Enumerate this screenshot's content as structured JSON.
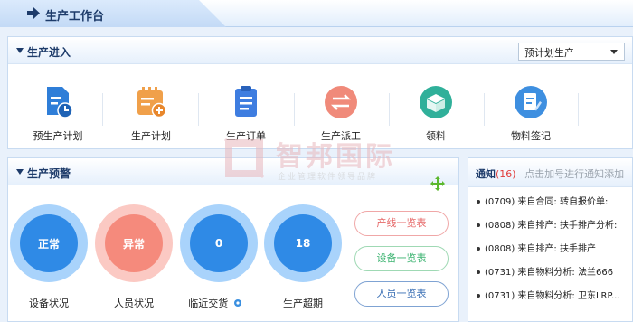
{
  "page_title": "生产工作台",
  "entry": {
    "title": "生产进入",
    "select_value": "预计划生产",
    "items": [
      {
        "label": "预生产计划",
        "icon": "plan-chart-icon",
        "color": "#2f7ed8"
      },
      {
        "label": "生产计划",
        "icon": "calendar-add-icon",
        "color": "#f0a04a"
      },
      {
        "label": "生产订单",
        "icon": "clipboard-list-icon",
        "color": "#3e7de0"
      },
      {
        "label": "生产派工",
        "icon": "swap-arrows-icon",
        "color": "#f08a7a"
      },
      {
        "label": "领料",
        "icon": "open-box-icon",
        "color": "#30b09a"
      },
      {
        "label": "物料签记",
        "icon": "note-pen-icon",
        "color": "#3e8fe0"
      }
    ]
  },
  "warning": {
    "title": "生产预警",
    "status": [
      {
        "value": "正常",
        "label": "设备状况",
        "color": "#2f8ae6",
        "ring": "#a9d3fb"
      },
      {
        "value": "异常",
        "label": "人员状况",
        "color": "#f58a7c",
        "ring": "#fbc9c3"
      },
      {
        "value": "0",
        "label": "临近交货",
        "color": "#2f8ae6",
        "ring": "#a9d3fb"
      },
      {
        "value": "18",
        "label": "生产超期",
        "color": "#2f8ae6",
        "ring": "#a9d3fb"
      }
    ],
    "buttons": [
      {
        "label": "产线一览表",
        "color": "#e66a6a"
      },
      {
        "label": "设备一览表",
        "color": "#3cb371"
      },
      {
        "label": "人员一览表",
        "color": "#3a6fb5"
      }
    ]
  },
  "notice": {
    "title": "通知",
    "count": "(16)",
    "hint": "点击加号进行通知添加",
    "items": [
      "(0709) 来自合同: 转自报价单:",
      "(0808) 来自排产: 扶手排产分析:",
      "(0808) 来自排产: 扶手排产",
      "(0731) 来自物料分析: 法兰666",
      "(0731) 来自物料分析: 卫东LRP..."
    ]
  },
  "watermark": {
    "name": "智邦国际",
    "slogan": "企业管理软件领导品牌"
  }
}
